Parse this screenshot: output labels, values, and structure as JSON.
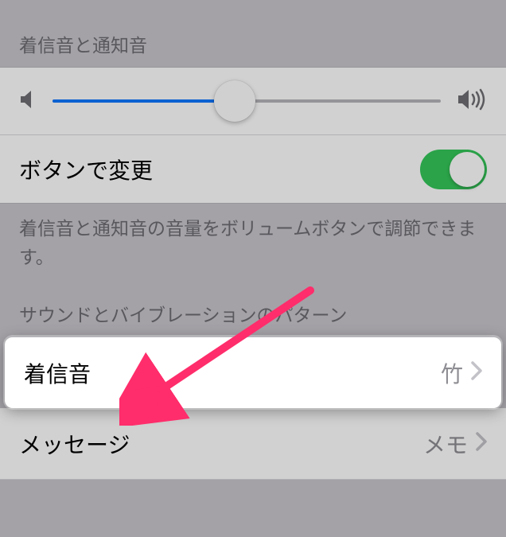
{
  "sections": {
    "ringer_header": "着信音と通知音",
    "pattern_header": "サウンドとバイブレーションのパターン"
  },
  "slider": {
    "value_percent": 47
  },
  "toggle": {
    "label": "ボタンで変更",
    "on": true
  },
  "footer": {
    "text": "着信音と通知音の音量をボリュームボタンで調節できます。"
  },
  "rows": {
    "ringtone": {
      "label": "着信音",
      "value": "竹"
    },
    "message": {
      "label": "メッセージ",
      "value": "メモ"
    }
  }
}
